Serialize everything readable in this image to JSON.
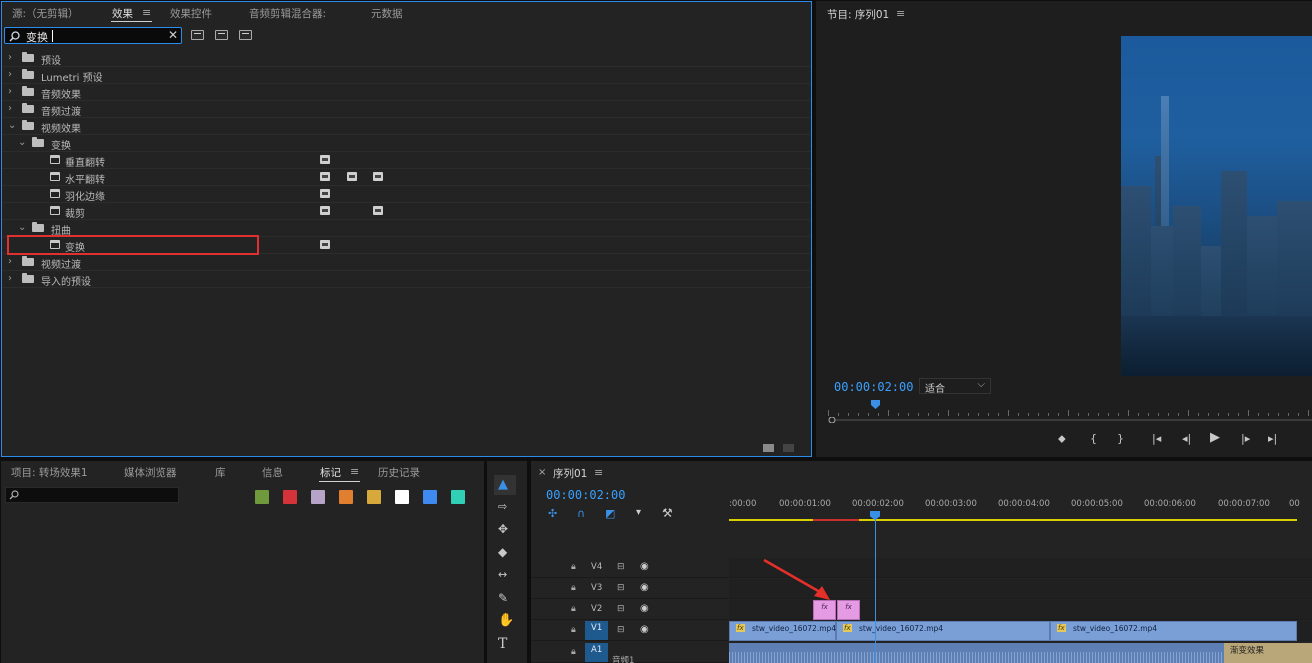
{
  "effects_panel": {
    "tabs": [
      "源:（无剪辑）",
      "效果",
      "效果控件",
      "音频剪辑混合器:",
      "元数据"
    ],
    "active_tab": "效果",
    "search": {
      "value": "变换",
      "clear": "✕"
    },
    "tree": [
      {
        "label": "预设",
        "indent": 0,
        "expanded": false,
        "kind": "preset-folder"
      },
      {
        "label": "Lumetri 预设",
        "indent": 0,
        "expanded": false,
        "kind": "preset-folder"
      },
      {
        "label": "音频效果",
        "indent": 0,
        "expanded": false,
        "kind": "folder"
      },
      {
        "label": "音频过渡",
        "indent": 0,
        "expanded": false,
        "kind": "folder"
      },
      {
        "label": "视频效果",
        "indent": 0,
        "expanded": true,
        "kind": "folder"
      },
      {
        "label": "变换",
        "indent": 1,
        "expanded": true,
        "kind": "folder"
      },
      {
        "label": "垂直翻转",
        "indent": 2,
        "kind": "effect",
        "badges": [
          1,
          0,
          0
        ]
      },
      {
        "label": "水平翻转",
        "indent": 2,
        "kind": "effect",
        "badges": [
          1,
          1,
          1
        ]
      },
      {
        "label": "羽化边缘",
        "indent": 2,
        "kind": "effect",
        "badges": [
          1,
          0,
          0
        ]
      },
      {
        "label": "裁剪",
        "indent": 2,
        "kind": "effect",
        "badges": [
          1,
          0,
          1
        ]
      },
      {
        "label": "扭曲",
        "indent": 1,
        "expanded": true,
        "kind": "folder"
      },
      {
        "label": "变换",
        "indent": 2,
        "kind": "effect",
        "badges": [
          1,
          0,
          0
        ]
      },
      {
        "label": "视频过渡",
        "indent": 0,
        "expanded": false,
        "kind": "folder"
      },
      {
        "label": "导入的预设",
        "indent": 0,
        "expanded": false,
        "kind": "preset-folder"
      }
    ]
  },
  "program_monitor": {
    "title": "节目: 序列01",
    "timecode": "00:00:02:00",
    "fit": "适合",
    "buttons": [
      "⬥",
      "{",
      "}",
      "|◂",
      "◂|",
      "▶",
      "|▸",
      "▸|"
    ]
  },
  "project_panel": {
    "tabs": [
      "项目: 转场效果1",
      "媒体浏览器",
      "库",
      "信息",
      "标记",
      "历史记录"
    ],
    "active_tab": "标记",
    "swatches": [
      "#6e9a3b",
      "#d43339",
      "#b6a3c8",
      "#e07f2f",
      "#d7a93a",
      "#ffffff",
      "#3f8af0",
      "#2fd0b6"
    ]
  },
  "timeline": {
    "title": "序列01",
    "close": "×",
    "timecode": "00:00:02:00",
    "ruler": [
      ":00:00",
      "00:00:01:00",
      "00:00:02:00",
      "00:00:03:00",
      "00:00:04:00",
      "00:00:05:00",
      "00:00:06:00",
      "00:00:07:00",
      "00"
    ],
    "tracks": [
      "V4",
      "V3",
      "V2",
      "V1",
      "A1"
    ],
    "fx_clips": [
      "fx",
      "fx"
    ],
    "v1_clips": [
      "stw_video_16072.mp4",
      "stw_video_16072.mp4",
      "stw_video_16072.mp4"
    ],
    "fx_badge": "fx",
    "audio_label": "音频1",
    "audio_end_label": "渐变效果"
  },
  "colors": {
    "accent": "#2d8ceb",
    "highlight": "#e0302f",
    "fx_clip": "#e59be3",
    "video_clip": "#7a9fd6"
  }
}
